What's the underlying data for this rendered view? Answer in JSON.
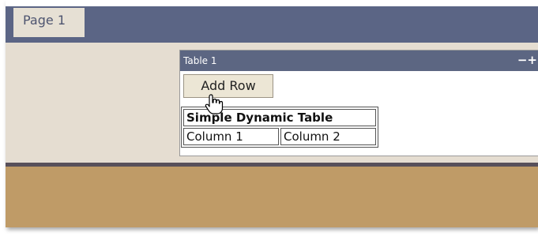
{
  "tab": {
    "label": "Page 1"
  },
  "widget": {
    "title": "Table 1",
    "controls": "−+",
    "add_row_label": "Add Row",
    "table": {
      "caption": "Simple Dynamic Table",
      "columns": [
        "Column 1",
        "Column 2"
      ]
    }
  },
  "icons": {
    "cursor": "hand-pointer-icon"
  },
  "colors": {
    "topbar": "#5b6585",
    "workspace": "#e5ddd1",
    "widget_header": "#5c6682",
    "footer": "#bf9b67",
    "button": "#ece6d5"
  }
}
